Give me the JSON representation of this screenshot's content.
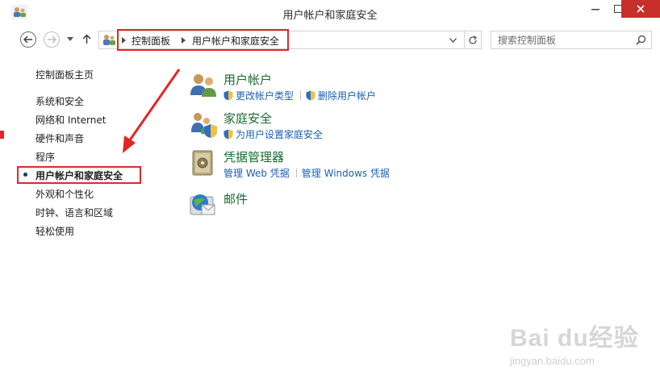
{
  "window": {
    "title": "用户帐户和家庭安全"
  },
  "address_bar": {
    "crumbs": [
      "控制面板",
      "用户帐户和家庭安全"
    ]
  },
  "search": {
    "placeholder": "搜索控制面板"
  },
  "left_nav": {
    "home": "控制面板主页",
    "items": [
      "系统和安全",
      "网络和 Internet",
      "硬件和声音",
      "程序",
      "用户帐户和家庭安全",
      "外观和个性化",
      "时钟、语言和区域",
      "轻松使用"
    ],
    "active_index": 4
  },
  "categories": [
    {
      "title": "用户帐户",
      "icon": "users-icon",
      "links": [
        {
          "label": "更改帐户类型",
          "shield": true
        },
        {
          "label": "删除用户帐户",
          "shield": true
        }
      ]
    },
    {
      "title": "家庭安全",
      "icon": "family-safety-icon",
      "links": [
        {
          "label": "为用户设置家庭安全",
          "shield": true
        }
      ]
    },
    {
      "title": "凭据管理器",
      "icon": "credential-vault-icon",
      "links": [
        {
          "label": "管理 Web 凭据",
          "shield": false
        },
        {
          "label": "管理 Windows 凭据",
          "shield": false
        }
      ]
    },
    {
      "title": "邮件",
      "icon": "mail-icon",
      "links": []
    }
  ],
  "watermark": {
    "brand": "Bai du经验",
    "sub": "jingyan.baidu.com"
  },
  "colors": {
    "annotation_red": "#e32727",
    "category_green": "#1a6b2f",
    "link_blue": "#1a5fb4",
    "close_red": "#c7302a"
  }
}
